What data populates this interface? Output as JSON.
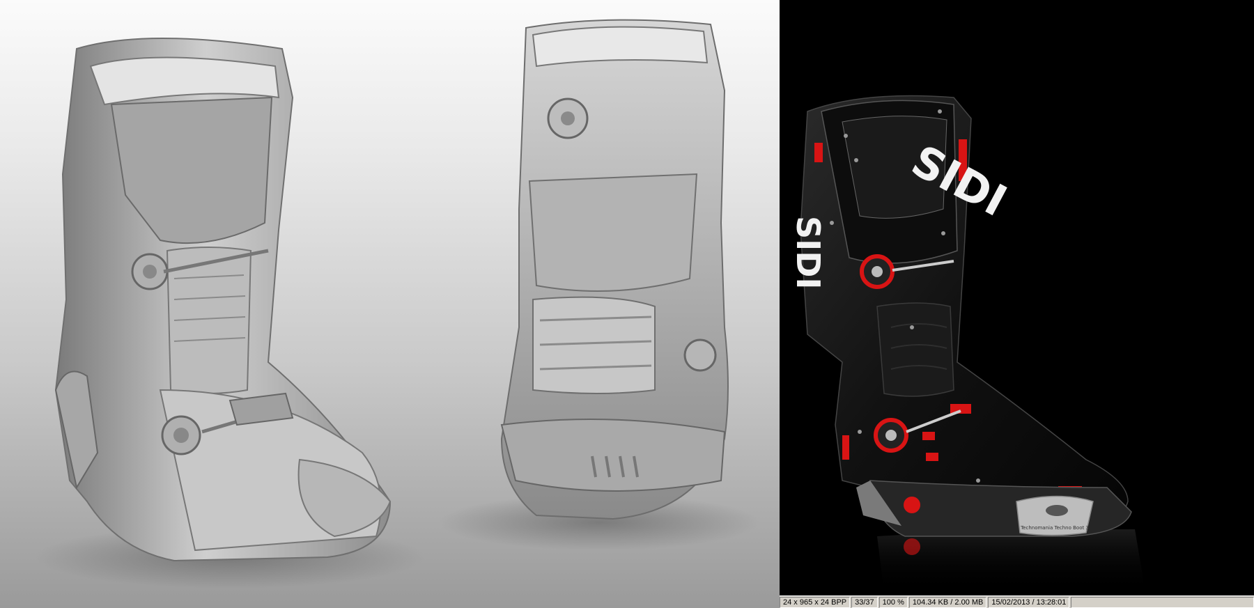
{
  "status_bar": {
    "dimensions": "24 x 965 x 24 BPP",
    "index": "33/37",
    "zoom": "100 %",
    "memory": "104.34 KB / 2.00 MB",
    "datetime": "15/02/2013 / 13:28:01"
  },
  "boot_brand": {
    "logo_text": "SIDI",
    "toe_plate_text": "Technomania Techno Boot 3"
  },
  "colors": {
    "accent_red": "#d81414",
    "boot_black": "#141414",
    "status_bar_bg": "#d4d0c8"
  }
}
